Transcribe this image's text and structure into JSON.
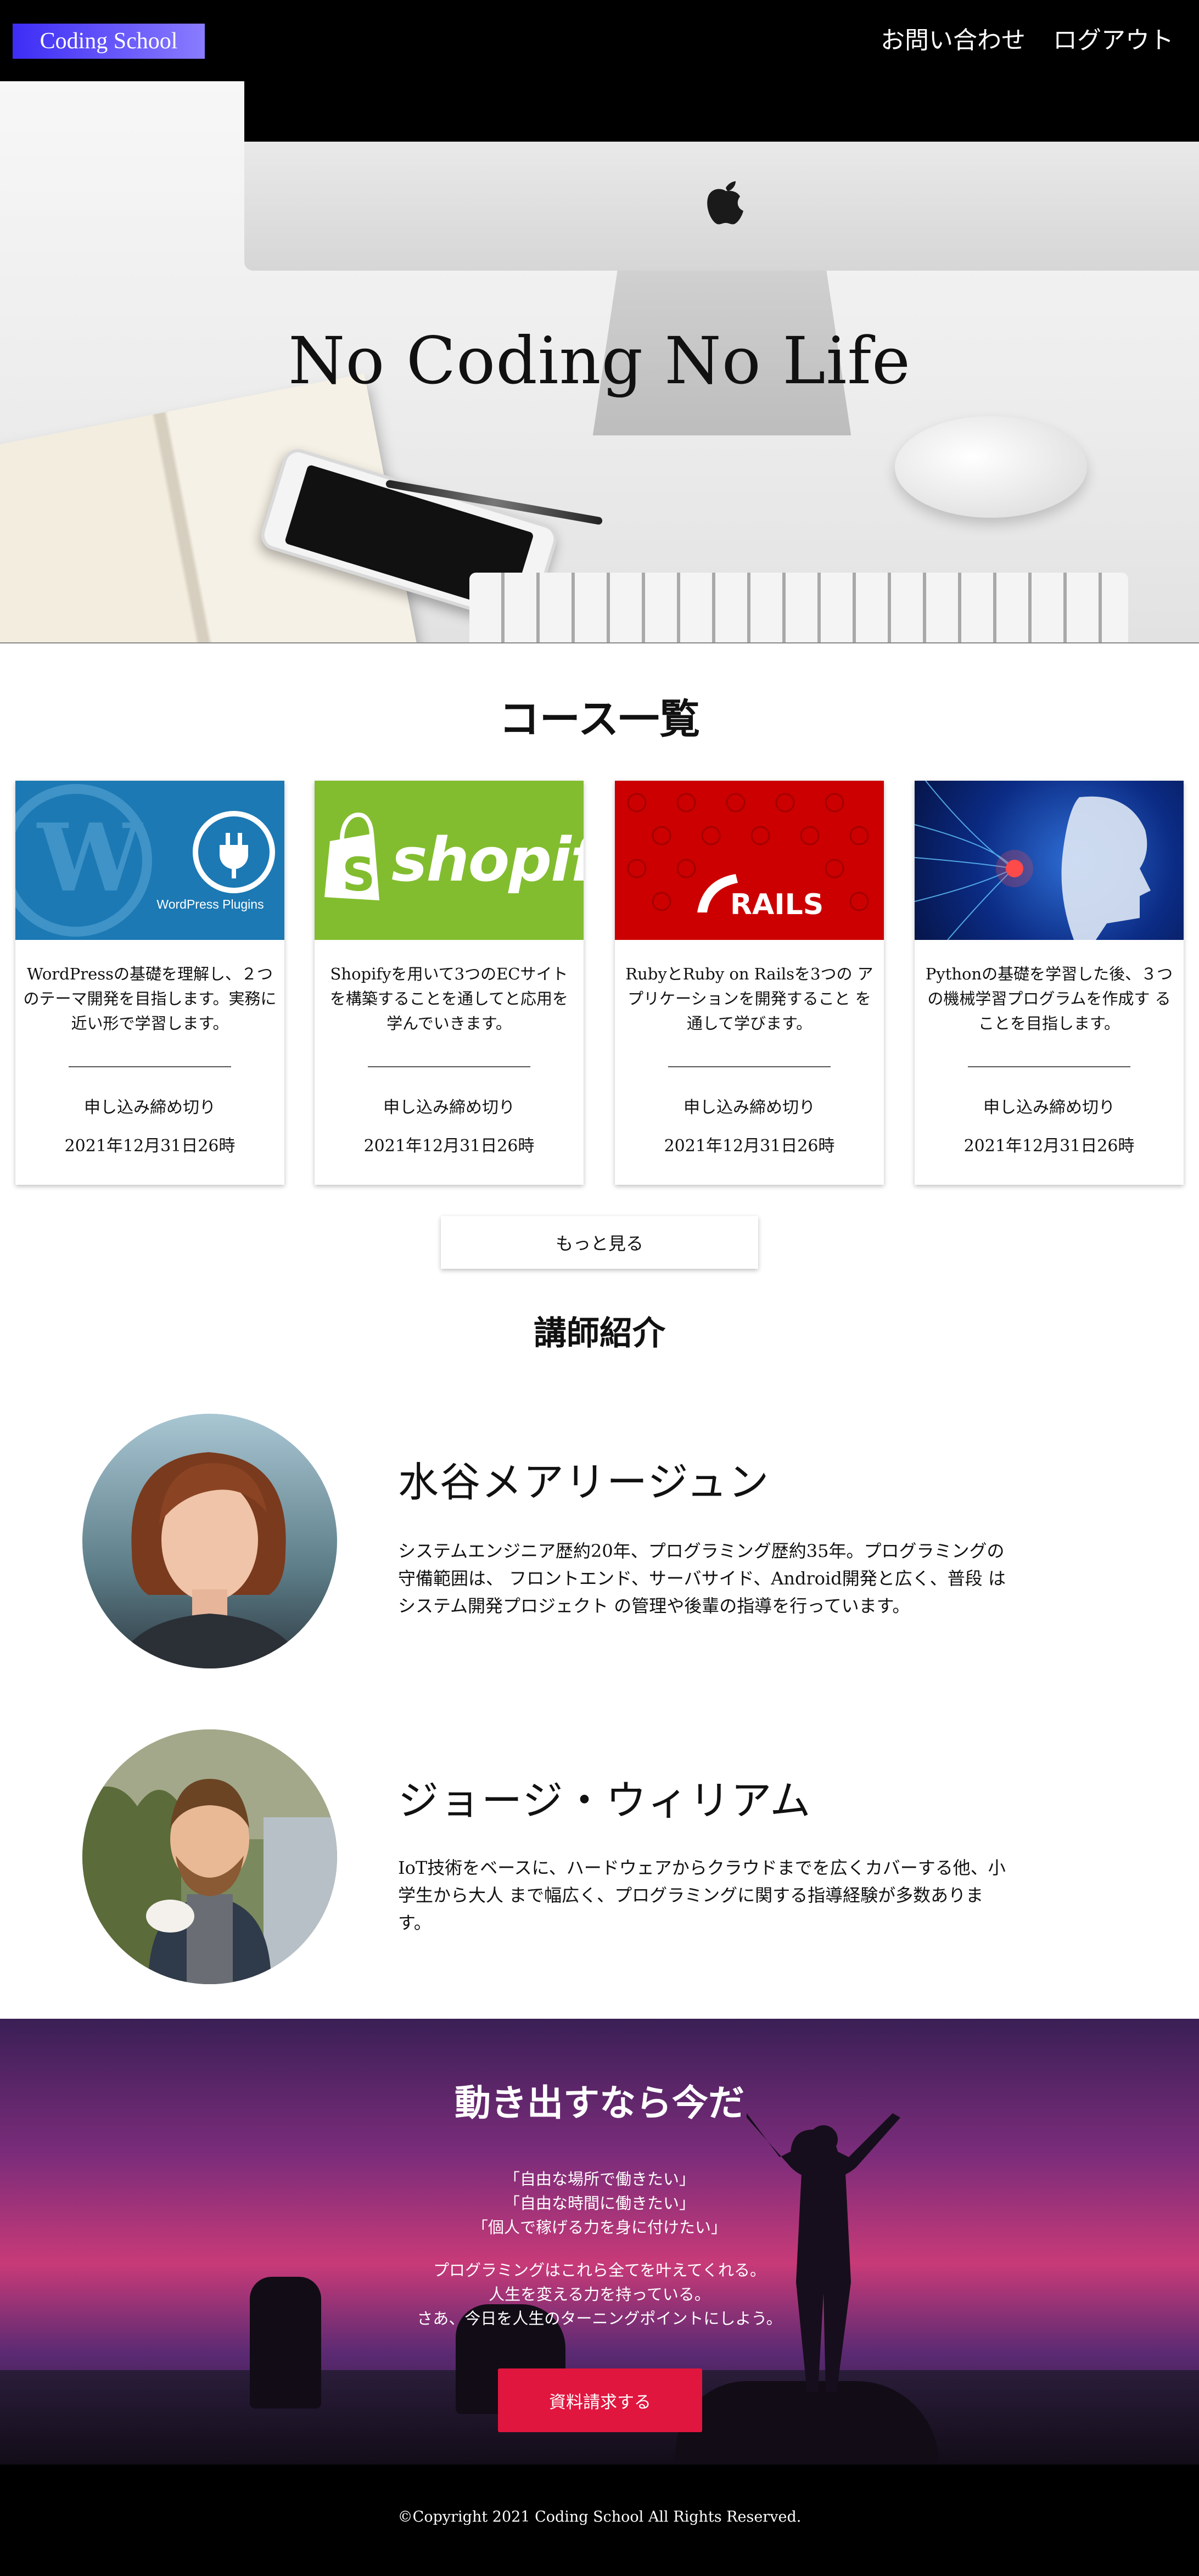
{
  "header": {
    "logo": "Coding School",
    "nav": [
      {
        "label": "お問い合わせ"
      },
      {
        "label": "ログアウト"
      }
    ]
  },
  "hero": {
    "title": "No Coding No Life"
  },
  "courses": {
    "title": "コース一覧",
    "items": [
      {
        "thumb_label": "WordPress Plugins",
        "description": "WordPressの基礎を理解し、２つのテーマ開発を目指します。実務に近い形で学習します。",
        "deadline_label": "申し込み締め切り",
        "deadline": "2021年12月31日26時",
        "color": "#1c79b4"
      },
      {
        "thumb_label": "shopify",
        "description": "Shopifyを用いて3つのECサイト を構築することを通してと応用を 学んでいきます。",
        "deadline_label": "申し込み締め切り",
        "deadline": "2021年12月31日26時",
        "color": "#82bd2f"
      },
      {
        "thumb_label": "RAILS",
        "description": "RubyとRuby on Railsを3つの アプリケーションを開発すること を通して学びます。",
        "deadline_label": "申し込み締め切り",
        "deadline": "2021年12月31日26時",
        "color": "#cc0000"
      },
      {
        "thumb_label": "",
        "description": "Pythonの基礎を学習した後、３つの機械学習プログラムを作成す ることを目指します。",
        "deadline_label": "申し込み締め切り",
        "deadline": "2021年12月31日26時",
        "color": "#0b2b84"
      }
    ],
    "more_button": "もっと見る"
  },
  "instructors": {
    "title": "講師紹介",
    "items": [
      {
        "name": "水谷メアリージュン",
        "bio": "システムエンジニア歴約20年、プログラミング歴約35年。プログラミングの守備範囲は、 フロントエンド、サーバサイド、Android開発と広く、普段 はシステム開発プロジェクト の管理や後輩の指導を行っています。"
      },
      {
        "name": "ジョージ・ウィリアム",
        "bio": "IoT技術をベースに、ハードウェアからクラウドまでを広くカバーする他、小学生から大人 まで幅広く、プログラミングに関する指導経験が多数あります。"
      }
    ]
  },
  "cta": {
    "title": "動き出すなら今だ",
    "quotes": [
      "「自由な場所で働きたい」",
      "「自由な時間に働きたい」",
      "「個人で稼げる力を身に付けたい」"
    ],
    "message": [
      "プログラミングはこれら全てを叶えてくれる。",
      "人生を変える力を持っている。",
      "さあ、今日を人生のターニングポイントにしよう。"
    ],
    "button": "資料請求する"
  },
  "footer": {
    "copyright": "©Copyright 2021 Coding School All Rights Reserved."
  }
}
